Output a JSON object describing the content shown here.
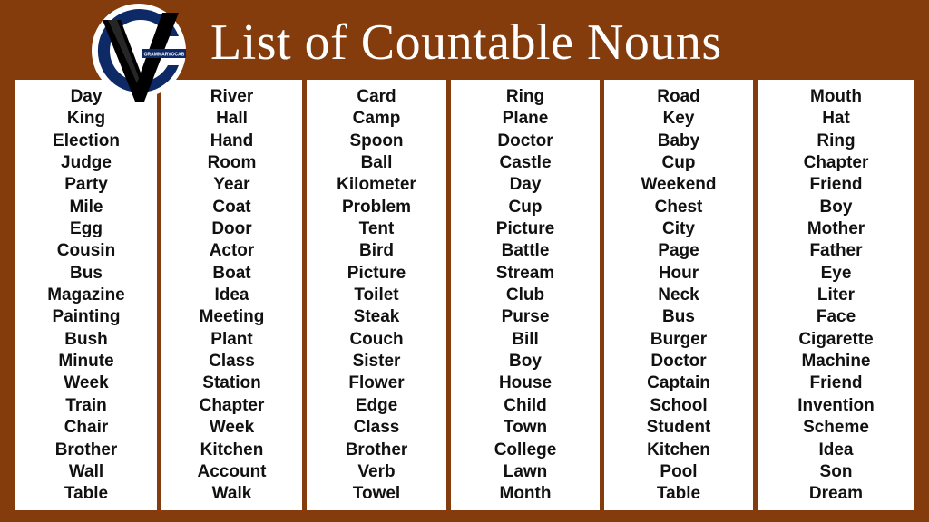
{
  "header": {
    "title": "List of Countable Nouns",
    "logo_text": "GRAMMARVOCAB"
  },
  "colors": {
    "background": "#843c0c",
    "panel": "#ffffff",
    "text": "#111111",
    "logo_ring": "#0d2a66",
    "logo_v": "#000000"
  },
  "columns": [
    {
      "words": [
        "Day",
        "King",
        "Election",
        "Judge",
        "Party",
        "Mile",
        "Egg",
        "Cousin",
        "Bus",
        "Magazine",
        "Painting",
        "Bush",
        "Minute",
        "Week",
        "Train",
        "Chair",
        "Brother",
        "Wall",
        "Table"
      ]
    },
    {
      "words": [
        "River",
        "Hall",
        "Hand",
        "Room",
        "Year",
        "Coat",
        "Door",
        "Actor",
        "Boat",
        "Idea",
        "Meeting",
        "Plant",
        "Class",
        "Station",
        "Chapter",
        "Week",
        "Kitchen",
        "Account",
        "Walk"
      ]
    },
    {
      "words": [
        "Card",
        "Camp",
        "Spoon",
        "Ball",
        "Kilometer",
        "Problem",
        "Tent",
        "Bird",
        "Picture",
        "Toilet",
        "Steak",
        "Couch",
        "Sister",
        "Flower",
        "Edge",
        "Class",
        "Brother",
        "Verb",
        "Towel"
      ]
    },
    {
      "words": [
        "Ring",
        "Plane",
        "Doctor",
        "Castle",
        "Day",
        "Cup",
        "Picture",
        "Battle",
        "Stream",
        "Club",
        "Purse",
        "Bill",
        "Boy",
        "House",
        "Child",
        "Town",
        "College",
        "Lawn",
        "Month"
      ]
    },
    {
      "words": [
        "Road",
        "Key",
        "Baby",
        "Cup",
        "Weekend",
        "Chest",
        "City",
        "Page",
        "Hour",
        "Neck",
        "Bus",
        "Burger",
        "Doctor",
        "Captain",
        "School",
        "Student",
        "Kitchen",
        "Pool",
        "Table"
      ]
    },
    {
      "words": [
        "Mouth",
        "Hat",
        "Ring",
        "Chapter",
        "Friend",
        "Boy",
        "Mother",
        "Father",
        "Eye",
        "Liter",
        "Face",
        "Cigarette",
        "Machine",
        "Friend",
        "Invention",
        "Scheme",
        "Idea",
        "Son",
        "Dream"
      ]
    }
  ]
}
